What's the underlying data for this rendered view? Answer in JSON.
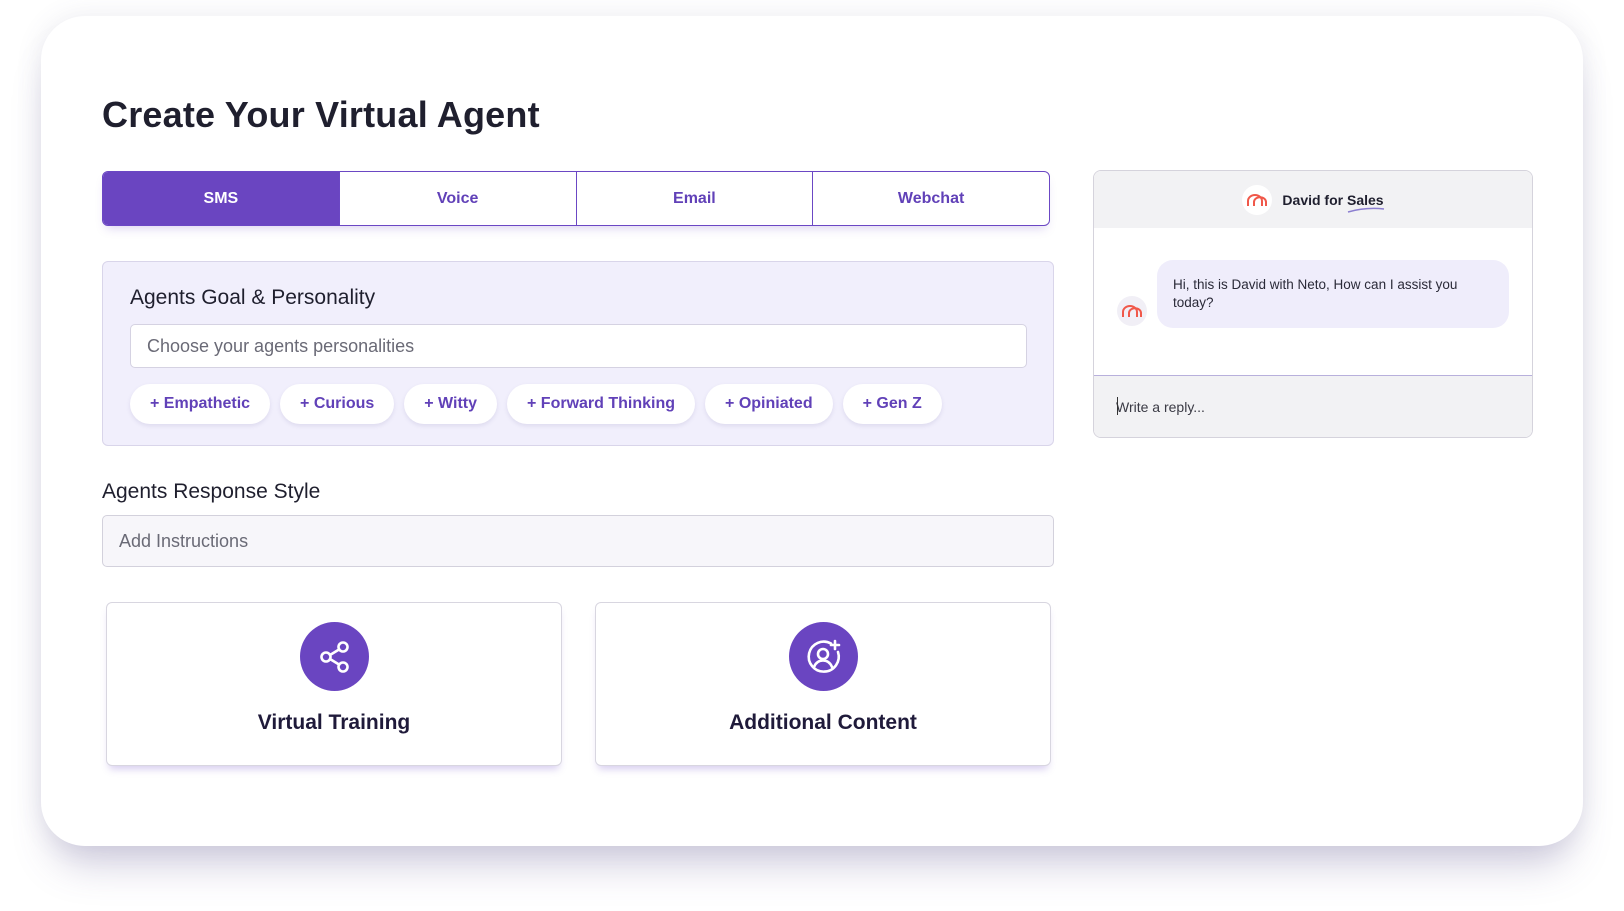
{
  "page": {
    "title": "Create Your Virtual Agent"
  },
  "tabs": [
    {
      "label": "SMS",
      "active": true
    },
    {
      "label": "Voice",
      "active": false
    },
    {
      "label": "Email",
      "active": false
    },
    {
      "label": "Webchat",
      "active": false
    }
  ],
  "goal": {
    "title": "Agents Goal & Personality",
    "placeholder": "Choose your agents personalities",
    "chips": [
      "+ Empathetic",
      "+ Curious",
      "+ Witty",
      "+ Forward Thinking",
      "+ Opiniated",
      "+ Gen Z"
    ]
  },
  "response": {
    "title": "Agents Response Style",
    "placeholder": "Add Instructions"
  },
  "features": [
    {
      "label": "Virtual Training",
      "icon": "share-icon"
    },
    {
      "label": "Additional Content",
      "icon": "add-user-icon"
    }
  ],
  "chat": {
    "agent_name": "David for Sales",
    "message": "Hi, this is David with Neto, How can I assist you today?",
    "reply_placeholder": "Write a reply..."
  },
  "colors": {
    "accent": "#6a45c1",
    "panel_bg": "#f1effc",
    "logo": "#f0584a"
  }
}
